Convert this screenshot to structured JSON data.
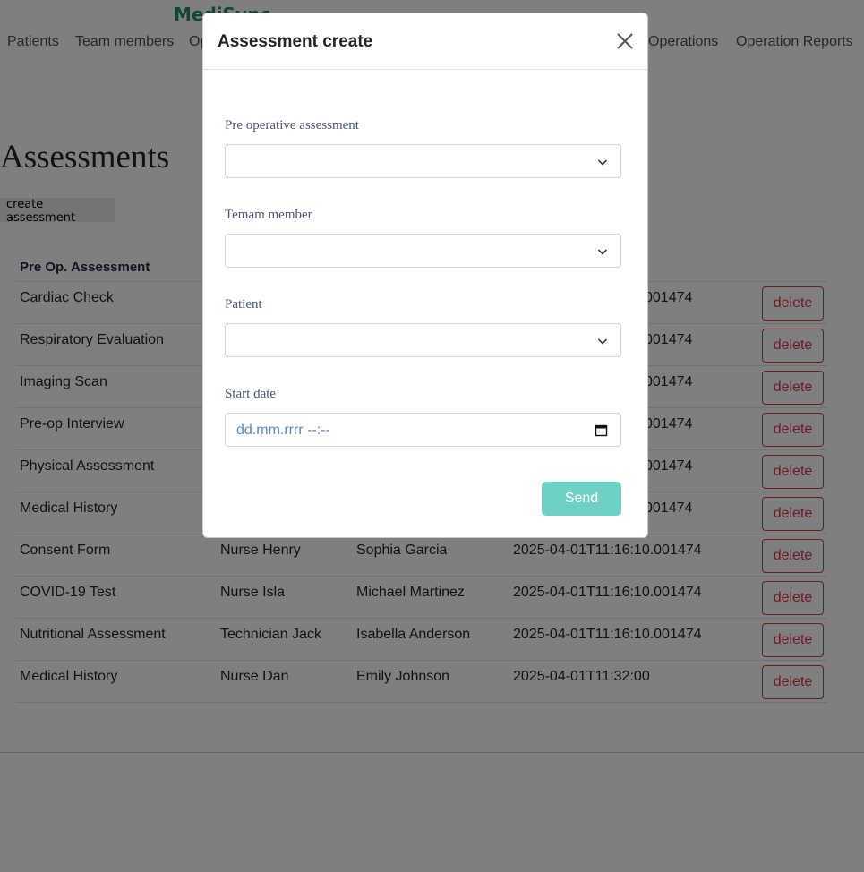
{
  "brand": "MediSync",
  "nav": {
    "items": [
      "Patients",
      "Team members",
      "Op",
      "Operations",
      "Operation Reports"
    ]
  },
  "page": {
    "title": "Assessments",
    "create_button": "create assessment"
  },
  "table": {
    "headers": [
      "Pre Op. Assessment",
      "",
      "",
      "",
      ""
    ],
    "rows": [
      {
        "assessment": "Cardiac Check",
        "member": "",
        "patient": "",
        "date": "001474",
        "action": "delete"
      },
      {
        "assessment": "Respiratory Evaluation",
        "member": "",
        "patient": "",
        "date": "001474",
        "action": "delete"
      },
      {
        "assessment": "Imaging Scan",
        "member": "",
        "patient": "",
        "date": "001474",
        "action": "delete"
      },
      {
        "assessment": "Pre-op Interview",
        "member": "",
        "patient": "",
        "date": "001474",
        "action": "delete"
      },
      {
        "assessment": "Physical Assessment",
        "member": "",
        "patient": "",
        "date": "001474",
        "action": "delete"
      },
      {
        "assessment": "Medical History",
        "member": "",
        "patient": "",
        "date": "001474",
        "action": "delete"
      },
      {
        "assessment": "Consent Form",
        "member": "Nurse Henry",
        "patient": "Sophia Garcia",
        "date": "2025-04-01T11:16:10.001474",
        "action": "delete"
      },
      {
        "assessment": "COVID-19 Test",
        "member": "Nurse Isla",
        "patient": "Michael Martinez",
        "date": "2025-04-01T11:16:10.001474",
        "action": "delete"
      },
      {
        "assessment": "Nutritional Assessment",
        "member": "Technician Jack",
        "patient": "Isabella Anderson",
        "date": "2025-04-01T11:16:10.001474",
        "action": "delete"
      },
      {
        "assessment": "Medical History",
        "member": "Nurse Dan",
        "patient": "Emily Johnson",
        "date": "2025-04-01T11:32:00",
        "action": "delete"
      }
    ]
  },
  "modal": {
    "title": "Assessment create",
    "fields": {
      "pre_op": {
        "label": "Pre operative assessment",
        "value": ""
      },
      "team_member": {
        "label": "Temam member",
        "value": ""
      },
      "patient": {
        "label": "Patient",
        "value": ""
      },
      "start_date": {
        "label": "Start date",
        "placeholder": "dd.mm.rrrr --:--"
      }
    },
    "submit_label": "Send"
  },
  "icons": {
    "close": "close-icon",
    "select_arrow": "chevron-down-icon",
    "calendar": "calendar-icon"
  },
  "colors": {
    "brand": "#1f8f6f",
    "danger": "#dc3545",
    "send_button": "#6fd1c3"
  }
}
